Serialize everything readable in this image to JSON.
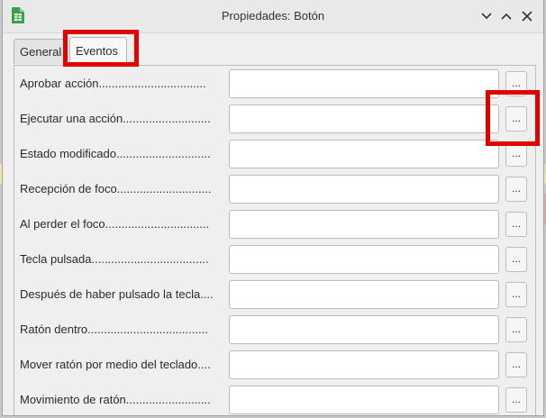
{
  "window": {
    "title": "Propiedades: Botón",
    "icon": "spreadsheet-icon",
    "controls": [
      "chevron-down-icon",
      "chevron-up-icon",
      "close-icon"
    ]
  },
  "tabs": [
    {
      "label": "General",
      "active": false
    },
    {
      "label": "Eventos",
      "active": true
    }
  ],
  "events": [
    {
      "label": "Aprobar acción.................................",
      "value": "",
      "button": "..."
    },
    {
      "label": "Ejecutar una acción...........................",
      "value": "",
      "button": "..."
    },
    {
      "label": "Estado modificado.............................",
      "value": "",
      "button": "..."
    },
    {
      "label": "Recepción de foco.............................",
      "value": "",
      "button": "..."
    },
    {
      "label": "Al perder el foco................................",
      "value": "",
      "button": "..."
    },
    {
      "label": "Tecla pulsada....................................",
      "value": "",
      "button": "..."
    },
    {
      "label": "Después de haber pulsado la tecla....",
      "value": "",
      "button": "..."
    },
    {
      "label": "Ratón dentro.....................................",
      "value": "",
      "button": "..."
    },
    {
      "label": "Mover ratón por medio del teclado....",
      "value": "",
      "button": "..."
    },
    {
      "label": "Movimiento de ratón..........................",
      "value": "",
      "button": "..."
    }
  ],
  "colors": {
    "highlight": "#e00000",
    "icon_green": "#3aa349"
  }
}
